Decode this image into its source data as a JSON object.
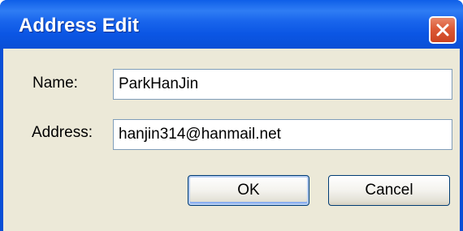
{
  "window": {
    "title": "Address Edit"
  },
  "form": {
    "name_label": "Name:",
    "name_value": "ParkHanJin",
    "address_label": "Address:",
    "address_value": "hanjin314@hanmail.net"
  },
  "buttons": {
    "ok_label": "OK",
    "cancel_label": "Cancel"
  },
  "icons": {
    "close": "close-icon"
  },
  "colors": {
    "titlebar": "#0a4fd6",
    "client_background": "#ece9d8",
    "close_button": "#dc5a36"
  }
}
